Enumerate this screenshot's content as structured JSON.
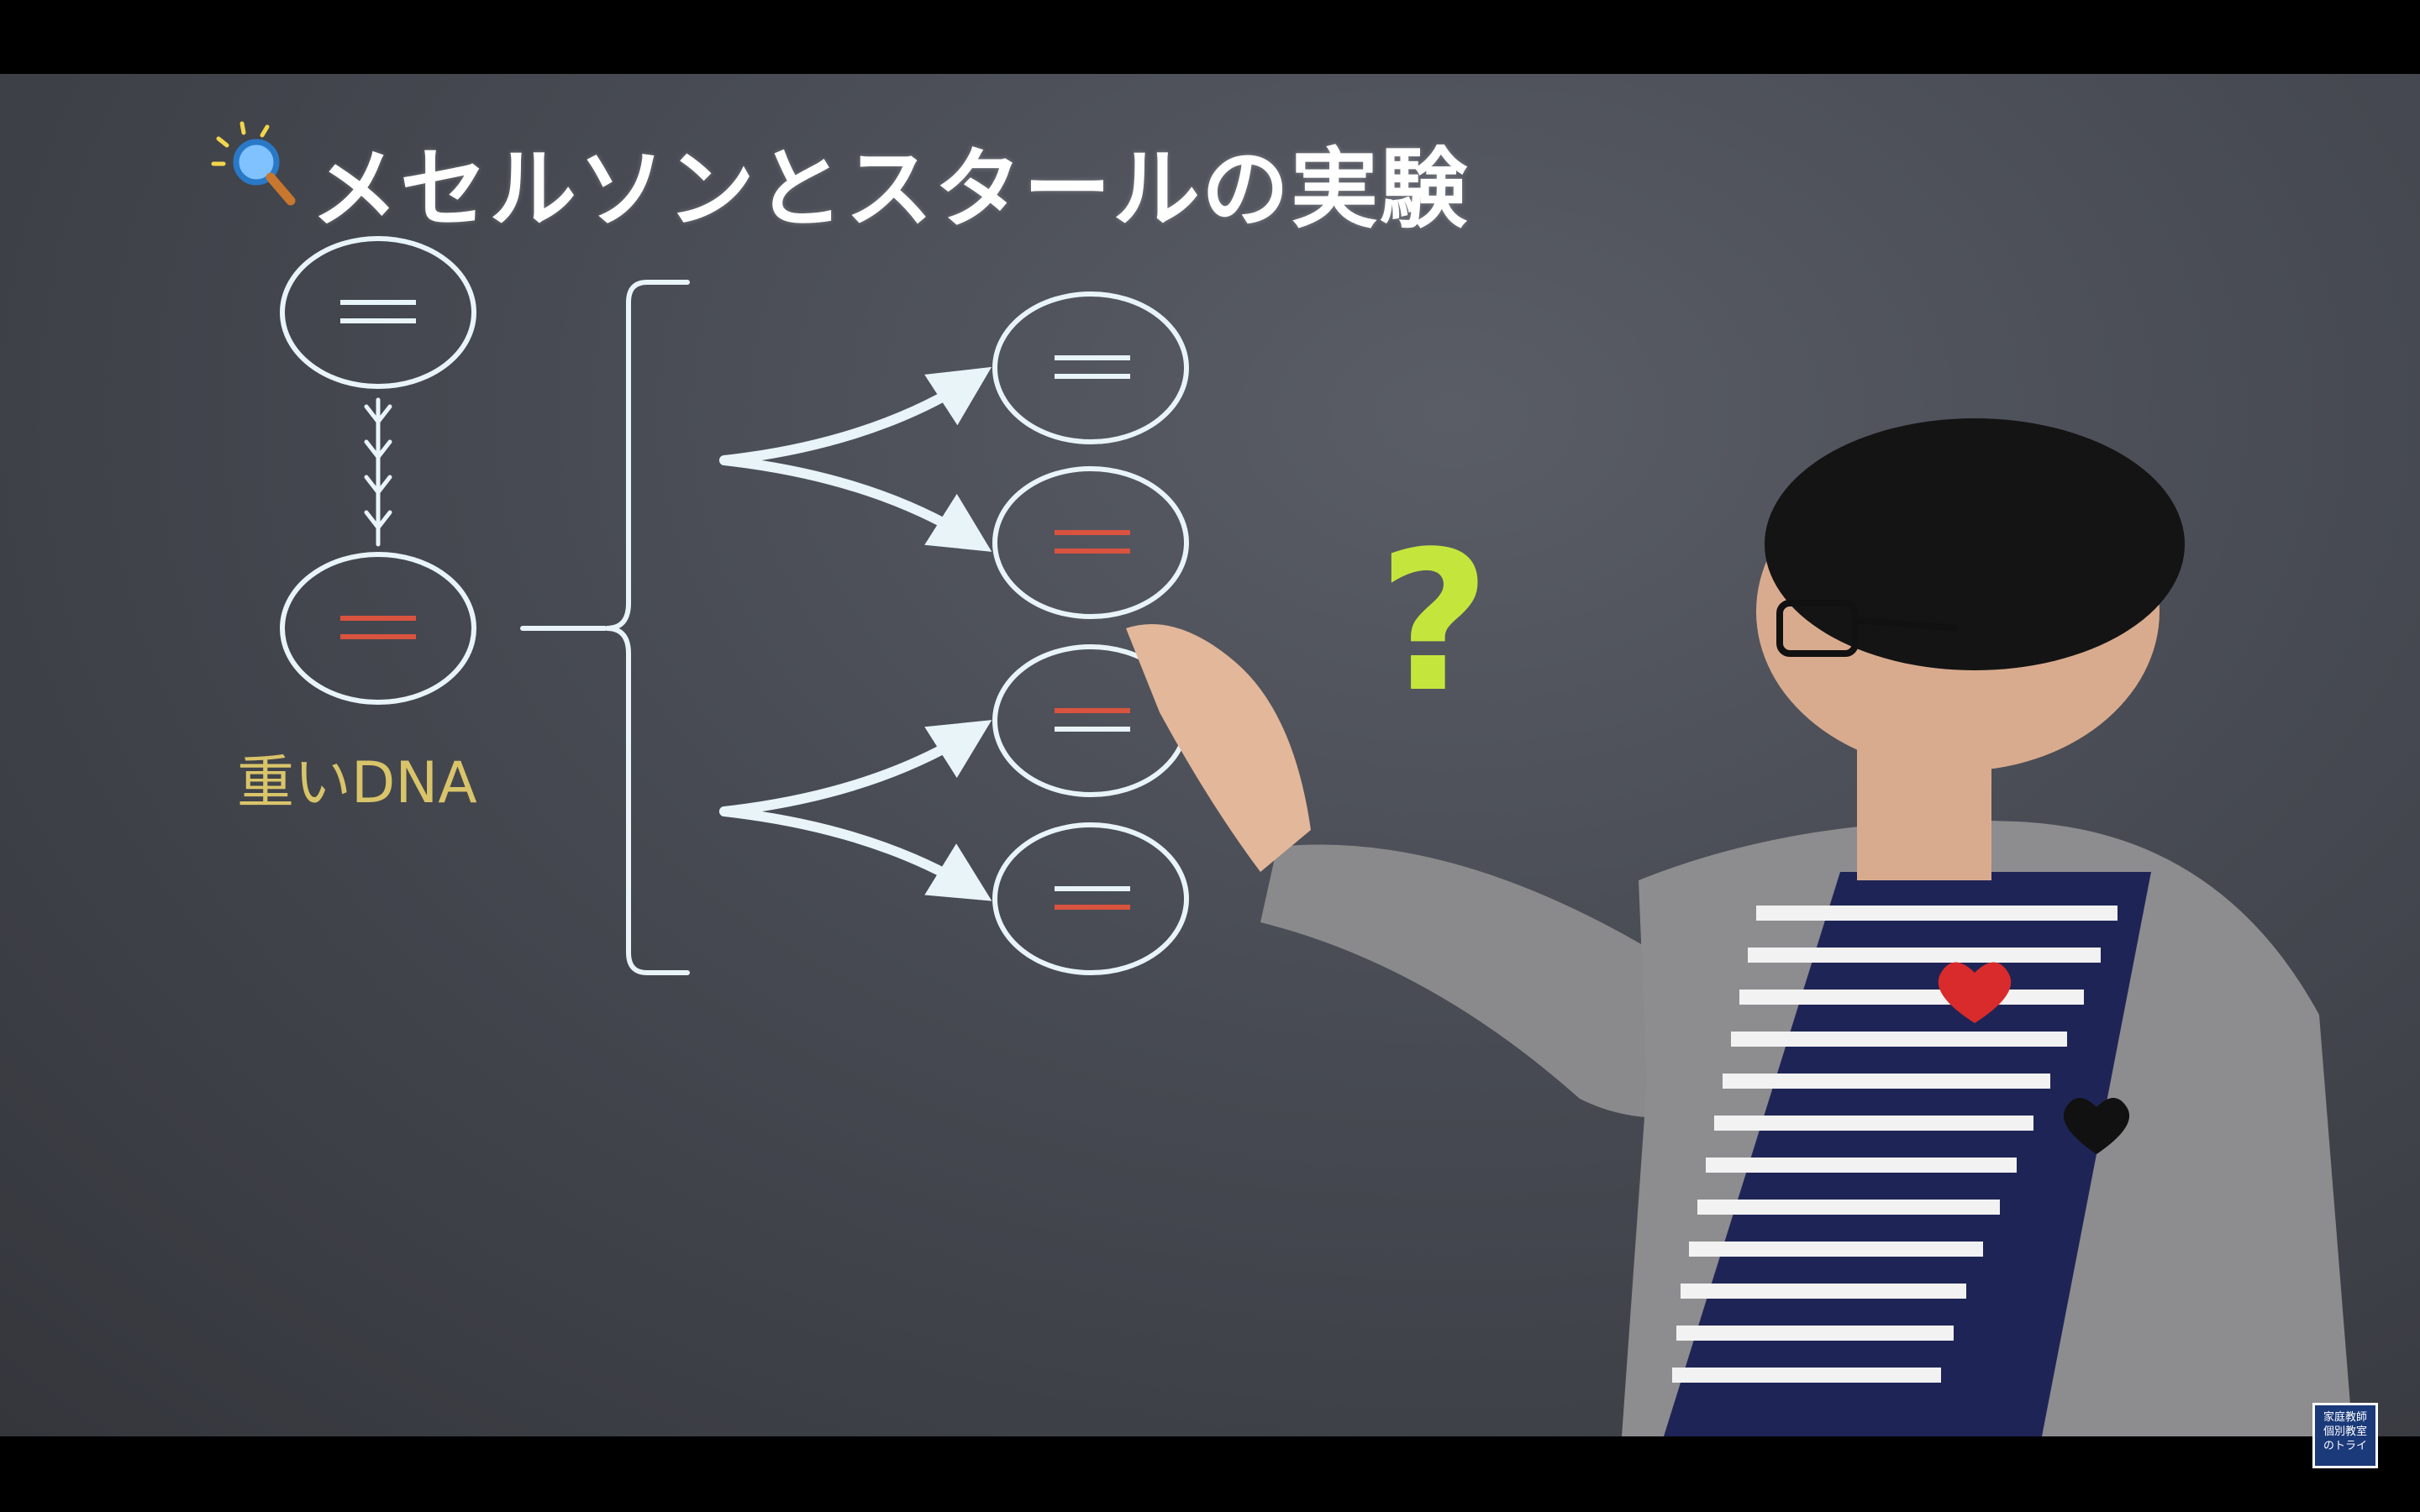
{
  "title": "メセルソンとスタールの実験",
  "title_icon": "magnifier-lightbulb-icon",
  "heavy_dna_label": "重いDNA",
  "question_mark": "?",
  "logo": {
    "lines": [
      "家庭教師",
      "個別教室",
      "のトライ"
    ]
  },
  "colors": {
    "board": "#474a52",
    "chalk": "#e8f4f8",
    "light_strand": "#e8f4f8",
    "heavy_strand": "#d9533f",
    "label": "#d9c46a",
    "question": "#c4e63c"
  }
}
